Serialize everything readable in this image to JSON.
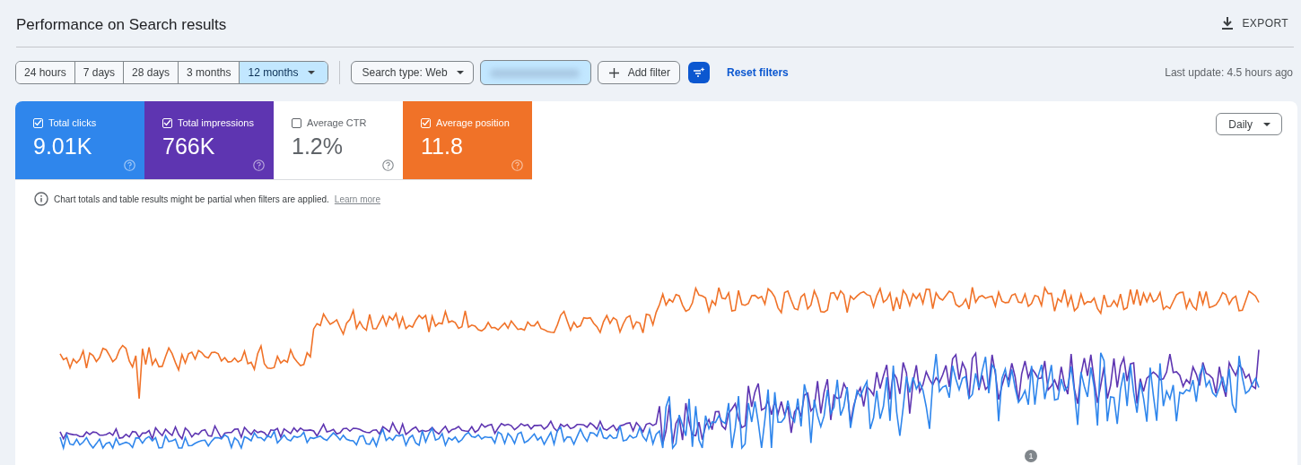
{
  "header": {
    "title": "Performance on Search results",
    "export_label": "EXPORT"
  },
  "date_ranges": [
    {
      "label": "24 hours",
      "selected": false
    },
    {
      "label": "7 days",
      "selected": false
    },
    {
      "label": "28 days",
      "selected": false
    },
    {
      "label": "3 months",
      "selected": false
    },
    {
      "label": "12 months",
      "selected": true
    }
  ],
  "filters": {
    "search_type": "Search type: Web",
    "add_filter": "Add filter",
    "reset": "Reset filters",
    "last_update": "Last update: 4.5 hours ago"
  },
  "metrics": [
    {
      "label": "Total clicks",
      "value": "9.01K",
      "checked": true,
      "color": "#2f86ec"
    },
    {
      "label": "Total impressions",
      "value": "766K",
      "checked": true,
      "color": "#5e35b1"
    },
    {
      "label": "Average CTR",
      "value": "1.2%",
      "checked": false
    },
    {
      "label": "Average position",
      "value": "11.8",
      "checked": true,
      "color": "#f07228"
    }
  ],
  "granularity": "Daily",
  "notice": {
    "text": "Chart totals and table results might be partial when filters are applied.",
    "link": "Learn more"
  },
  "chart": {
    "annotation": "1"
  }
}
